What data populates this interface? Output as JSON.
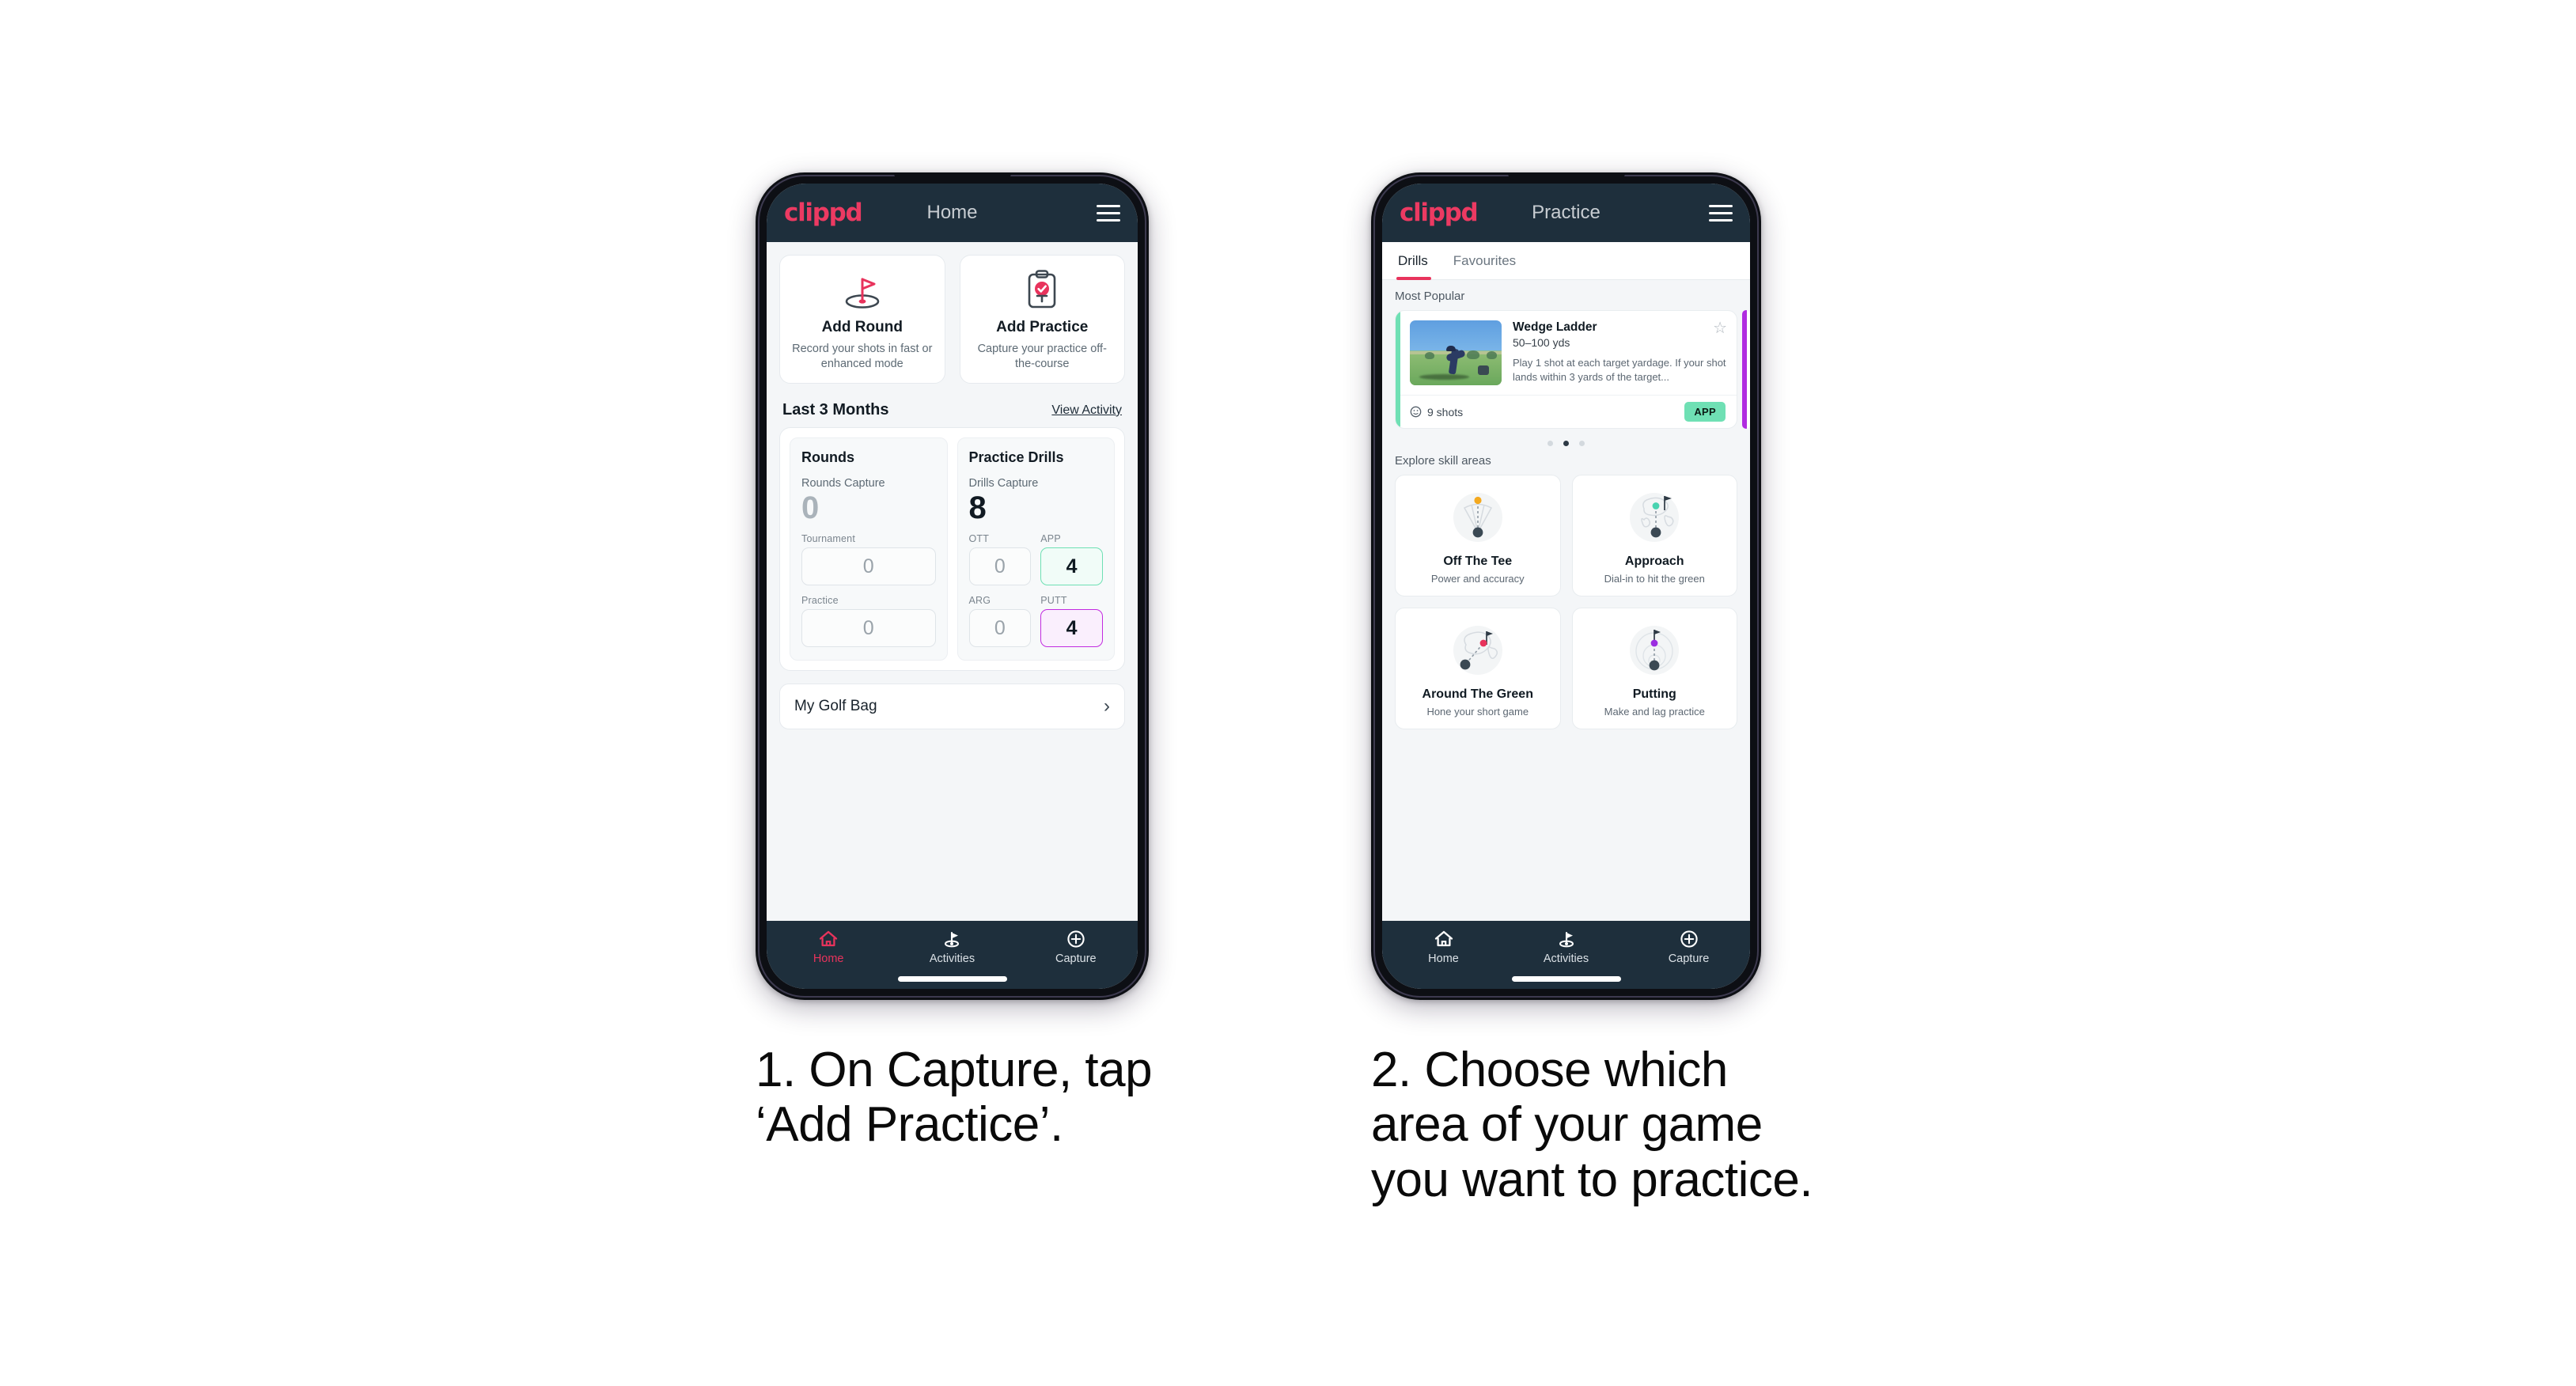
{
  "colors": {
    "brand_pink": "#e8335c",
    "appbar_navy": "#1e2f3c",
    "mint": "#6fe0b4",
    "purple": "#c22ce0",
    "page_bg": "#f4f6f8"
  },
  "phone1": {
    "appbar": {
      "logo": "clippd",
      "title": "Home",
      "menu_icon": "hamburger-icon"
    },
    "quick_actions": [
      {
        "icon": "golf-flag-hole-icon",
        "title": "Add Round",
        "desc": "Record your shots in fast or enhanced mode"
      },
      {
        "icon": "clipboard-check-tee-icon",
        "title": "Add Practice",
        "desc": "Capture your practice off-the-course"
      }
    ],
    "section": {
      "title": "Last 3 Months",
      "link": "View Activity"
    },
    "rounds": {
      "heading": "Rounds",
      "capture_label": "Rounds Capture",
      "capture_value": "0",
      "fields": [
        {
          "label": "Tournament",
          "value": "0",
          "state": "empty"
        },
        {
          "label": "Practice",
          "value": "0",
          "state": "empty"
        }
      ]
    },
    "drills": {
      "heading": "Practice Drills",
      "capture_label": "Drills Capture",
      "capture_value": "8",
      "fields": [
        {
          "label": "OTT",
          "value": "0",
          "state": "empty"
        },
        {
          "label": "APP",
          "value": "4",
          "state": "green"
        },
        {
          "label": "ARG",
          "value": "0",
          "state": "empty"
        },
        {
          "label": "PUTT",
          "value": "4",
          "state": "purple"
        }
      ]
    },
    "golf_bag": {
      "label": "My Golf Bag",
      "chevron": "chevron-right-icon"
    },
    "bottom_nav": [
      {
        "icon": "home-icon",
        "label": "Home",
        "active": true
      },
      {
        "icon": "golf-flag-icon",
        "label": "Activities",
        "active": false
      },
      {
        "icon": "plus-circle-icon",
        "label": "Capture",
        "active": false
      }
    ]
  },
  "phone2": {
    "appbar": {
      "logo": "clippd",
      "title": "Practice",
      "menu_icon": "hamburger-icon"
    },
    "tabs": [
      {
        "label": "Drills",
        "active": true
      },
      {
        "label": "Favourites",
        "active": false
      }
    ],
    "most_popular_label": "Most Popular",
    "drill_card": {
      "title": "Wedge Ladder",
      "yardage": "50–100 yds",
      "description": "Play 1 shot at each target yardage. If your shot lands within 3 yards of the target...",
      "shots": "9 shots",
      "tag": "APP",
      "favourite_icon": "star-outline-icon",
      "clock_icon": "clock-icon",
      "accent": "#6fe0b4",
      "thumbnail": "golfer-chipping-photo"
    },
    "carousel": {
      "total_dots": 3,
      "active_index": 1
    },
    "explore_label": "Explore skill areas",
    "skill_areas": [
      {
        "icon": "off-the-tee-icon",
        "name": "Off The Tee",
        "desc": "Power and accuracy"
      },
      {
        "icon": "approach-icon",
        "name": "Approach",
        "desc": "Dial-in to hit the green"
      },
      {
        "icon": "around-the-green-icon",
        "name": "Around The Green",
        "desc": "Hone your short game"
      },
      {
        "icon": "putting-icon",
        "name": "Putting",
        "desc": "Make and lag practice"
      }
    ],
    "bottom_nav": [
      {
        "icon": "home-icon",
        "label": "Home",
        "active": false
      },
      {
        "icon": "golf-flag-icon",
        "label": "Activities",
        "active": false
      },
      {
        "icon": "plus-circle-icon",
        "label": "Capture",
        "active": false
      }
    ]
  },
  "captions": {
    "step1": "1. On Capture, tap\n‘Add Practice’.",
    "step2": "2. Choose which\narea of your game\nyou want to practice."
  }
}
